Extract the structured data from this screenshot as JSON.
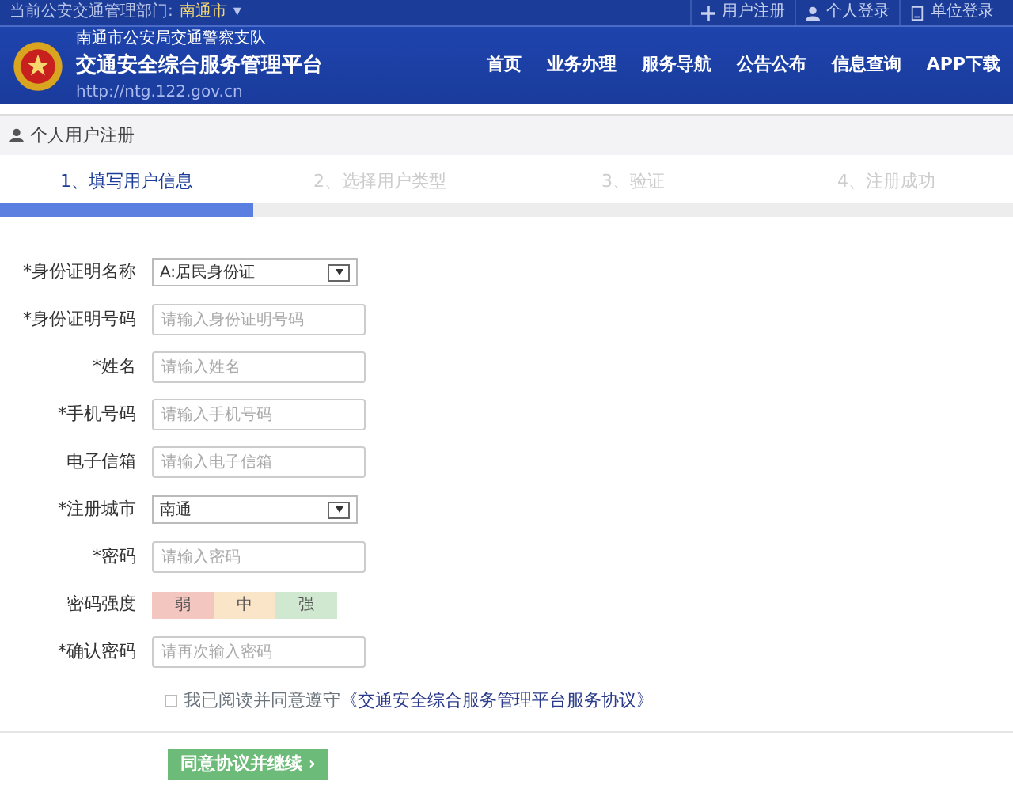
{
  "top_bar": {
    "label": "当前公安交通管理部门:",
    "city": "南通市",
    "caret": "▾",
    "links": [
      {
        "label": "用户注册",
        "kind": "plus"
      },
      {
        "label": "个人登录",
        "kind": "person"
      },
      {
        "label": "单位登录",
        "kind": "doc"
      }
    ]
  },
  "header": {
    "org": "南通市公安局交通警察支队",
    "title": "交通安全综合服务管理平台",
    "url": "http://ntg.122.gov.cn",
    "nav": [
      "首页",
      "业务办理",
      "服务导航",
      "公告公布",
      "信息查询",
      "APP下载"
    ]
  },
  "section_title": "个人用户注册",
  "steps": [
    {
      "label": "1、填写用户信息",
      "selected": true
    },
    {
      "label": "2、选择用户类型",
      "selected": false
    },
    {
      "label": "3、验证",
      "selected": false
    },
    {
      "label": "4、注册成功",
      "selected": false
    }
  ],
  "fields": [
    {
      "kind": "select",
      "label": "身份证明名称",
      "mark": "*",
      "value": "A:居民身份证"
    },
    {
      "kind": "text",
      "label": "身份证明号码",
      "mark": "*",
      "placeholder": "请输入身份证明号码"
    },
    {
      "kind": "text",
      "label": "姓名",
      "mark": "*",
      "placeholder": "请输入姓名"
    },
    {
      "kind": "text",
      "label": "手机号码",
      "mark": "*",
      "placeholder": "请输入手机号码"
    },
    {
      "kind": "text",
      "label": "电子信箱",
      "placeholder": "请输入电子信箱"
    },
    {
      "kind": "select",
      "label": "注册城市",
      "mark": "*",
      "value": "南通"
    },
    {
      "kind": "text",
      "label": "密码",
      "mark": "*",
      "placeholder": "请输入密码"
    },
    {
      "kind": "strength",
      "label": "密码强度",
      "segments": [
        {
          "label": "弱",
          "color": "#f4c6c0"
        },
        {
          "label": "中",
          "color": "#fbe5c8"
        },
        {
          "label": "强",
          "color": "#cfe8cf"
        }
      ]
    },
    {
      "kind": "text",
      "label": "确认密码",
      "mark": "*",
      "placeholder": "请再次输入密码"
    }
  ],
  "agreement": {
    "checked": false,
    "text": "我已阅读并同意遵守",
    "link": "《交通安全综合服务管理平台服务协议》"
  },
  "submit": {
    "label": "同意协议并继续",
    "icon": "›"
  }
}
